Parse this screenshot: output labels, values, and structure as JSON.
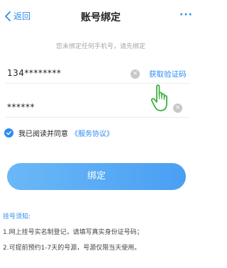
{
  "nav": {
    "back_label": "返回",
    "title": "账号绑定",
    "more_label": "···"
  },
  "hint": "您未绑定任何手机号，请先绑定",
  "form": {
    "phone_value": "134********",
    "code_value": "******",
    "get_code_label": "获取验证码",
    "clear_glyph": "×"
  },
  "agreement": {
    "text": "我已阅读并同意",
    "link": "《服务协议》",
    "checked": true
  },
  "bind_button": "绑定",
  "notes": {
    "title": "挂号须知:",
    "items": [
      "1.网上挂号实名制登记，请填写真实身份证号码；",
      "2.可提前预约1-7天的号源，号源仅限当天使用。"
    ]
  },
  "colors": {
    "accent": "#2d8cf0",
    "button": "#4a9ff3",
    "hand": "#3cb043"
  },
  "icons": {
    "back": "chevron-left-icon",
    "clear": "clear-icon",
    "check": "checkmark-icon",
    "pointer": "hand-pointer-icon"
  }
}
